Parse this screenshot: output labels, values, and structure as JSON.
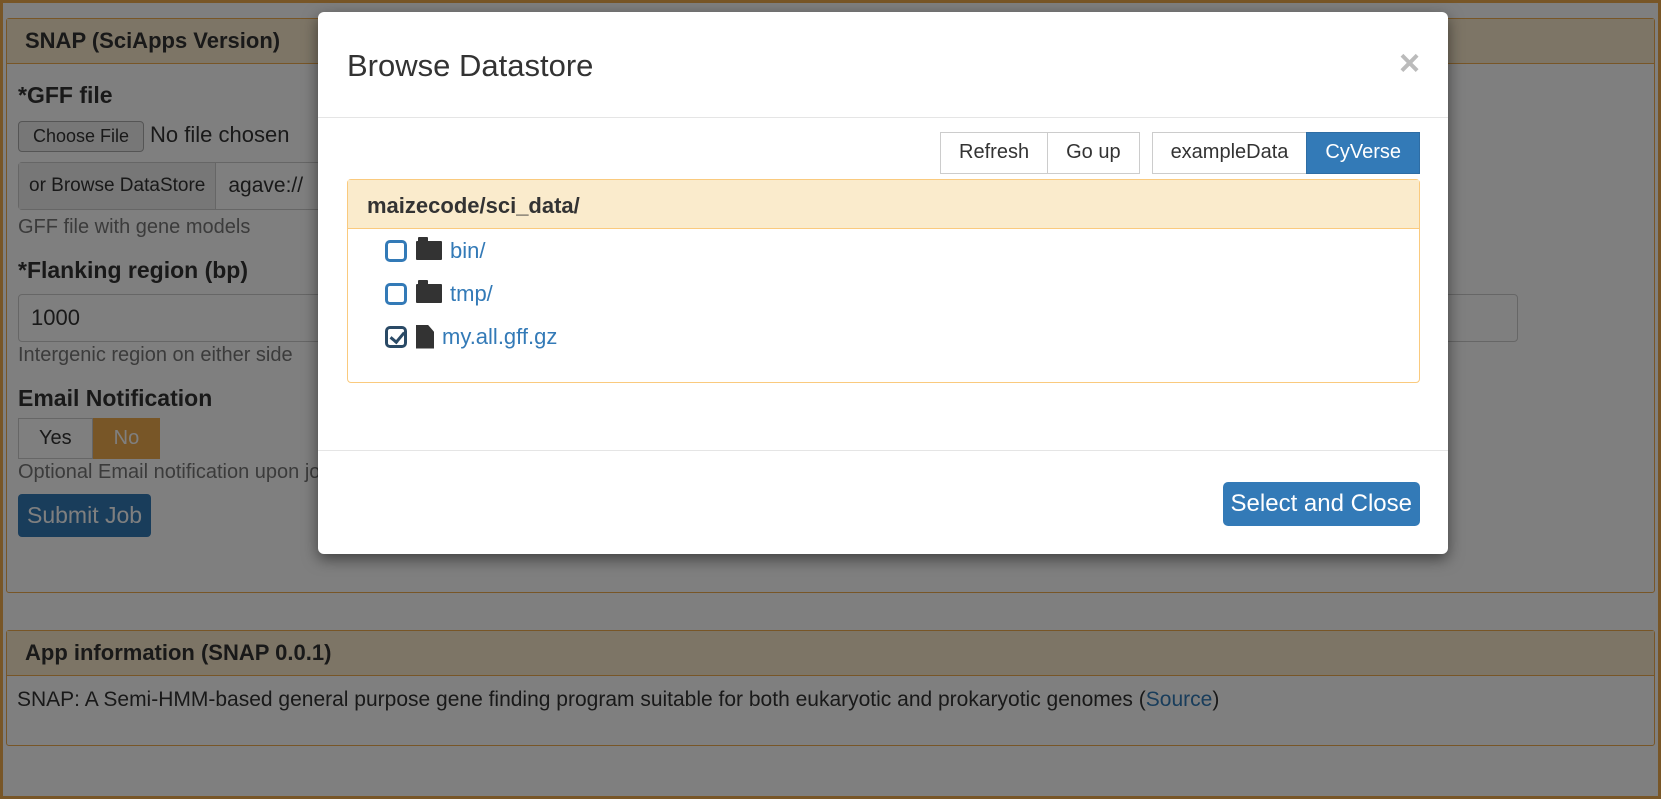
{
  "background": {
    "panel_title": "SNAP (SciApps Version)",
    "gff_label": "*GFF file",
    "choose_file": "Choose File",
    "no_file": "No file chosen",
    "browse_datastore": "or Browse DataStore",
    "datastore_value": "agave://",
    "gff_help": "GFF file with gene models",
    "flank_label": "*Flanking region (bp)",
    "flank_value": "1000",
    "flank_help": "Intergenic region on either side",
    "email_label": "Email Notification",
    "email_yes": "Yes",
    "email_no": "No",
    "email_help": "Optional Email notification upon job completion",
    "submit": "Submit Job",
    "info_title": "App information (SNAP 0.0.1)",
    "info_text": "SNAP: A Semi-HMM-based general purpose gene finding program suitable for both eukaryotic and prokaryotic genomes (",
    "info_link": "Source",
    "info_end": ")"
  },
  "modal": {
    "title": "Browse Datastore",
    "close": "×",
    "toolbar": {
      "refresh": "Refresh",
      "go_up": "Go up",
      "example": "exampleData",
      "cyverse": "CyVerse",
      "active": "CyVerse"
    },
    "path": "maizecode/sci_data/",
    "items": [
      {
        "name": "bin/",
        "type": "folder",
        "checked": false
      },
      {
        "name": "tmp/",
        "type": "folder",
        "checked": false
      },
      {
        "name": "my.all.gff.gz",
        "type": "file",
        "checked": true
      }
    ],
    "select_close": "Select and Close"
  },
  "colors": {
    "primary": "#337ab7",
    "warning": "#f0ad4e",
    "heading": "#faebcc"
  }
}
